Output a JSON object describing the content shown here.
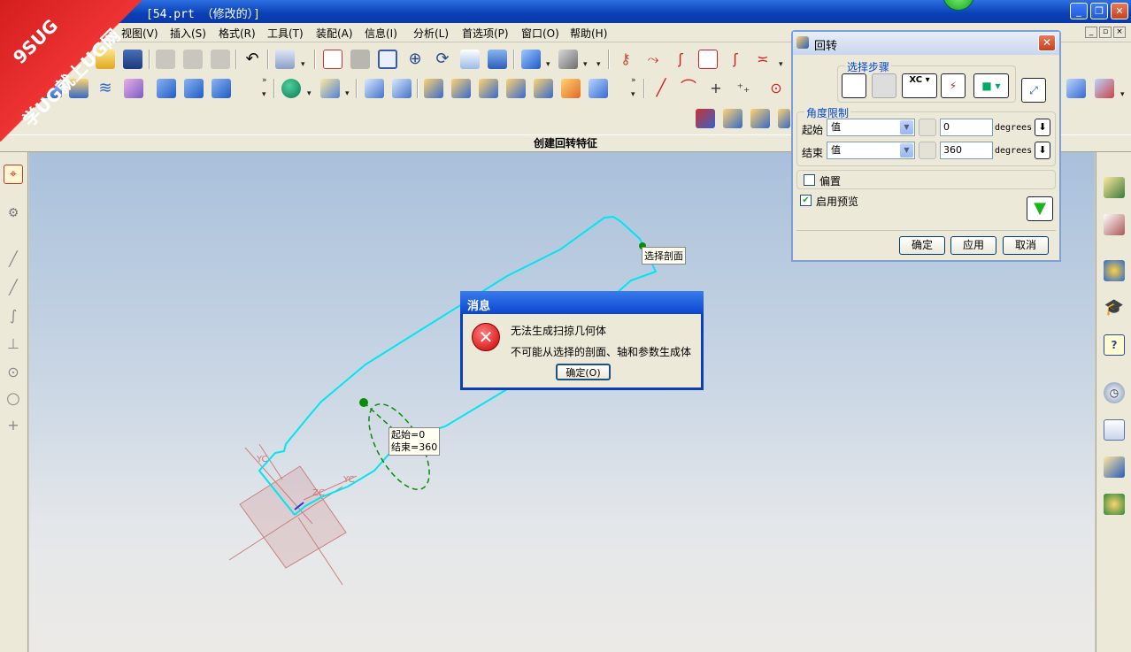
{
  "window": {
    "title": "[54.prt （修改的）]"
  },
  "watermark": {
    "line1": "9SUG",
    "line2": "学UG就上UG网"
  },
  "menu": {
    "items": [
      "视图(V)",
      "插入(S)",
      "格式(R)",
      "工具(T)",
      "装配(A)",
      "信息(I)",
      "分析(L)",
      "首选项(P)",
      "窗口(O)",
      "帮助(H)"
    ]
  },
  "status": {
    "prompt": "创建回转特征"
  },
  "revolve_dialog": {
    "title": "回转",
    "selection_steps_label": "选择步骤",
    "angle_limits_label": "角度限制",
    "start_label": "起始",
    "start_type": "值",
    "start_value": "0",
    "start_unit": "degrees",
    "end_label": "结束",
    "end_type": "值",
    "end_value": "360",
    "end_unit": "degrees",
    "offset_label": "偏置",
    "offset_checked": false,
    "preview_label": "启用预览",
    "preview_checked": true,
    "xc_label": "XC",
    "ok": "确定",
    "apply": "应用",
    "cancel": "取消"
  },
  "message_dialog": {
    "title": "消息",
    "line1": "无法生成扫掠几何体",
    "line2": "不可能从选择的剖面、轴和参数生成体",
    "ok": "确定(O)"
  },
  "viewport": {
    "select_section_tag": "选择剖面",
    "start_tag": "起始=0",
    "end_tag": "结束=360",
    "yc_label": "YC",
    "zc_label": "ZC"
  },
  "colors": {
    "curve": "#00e5f0",
    "axis": "#0b8a0b",
    "datum": "#c97a7a"
  }
}
